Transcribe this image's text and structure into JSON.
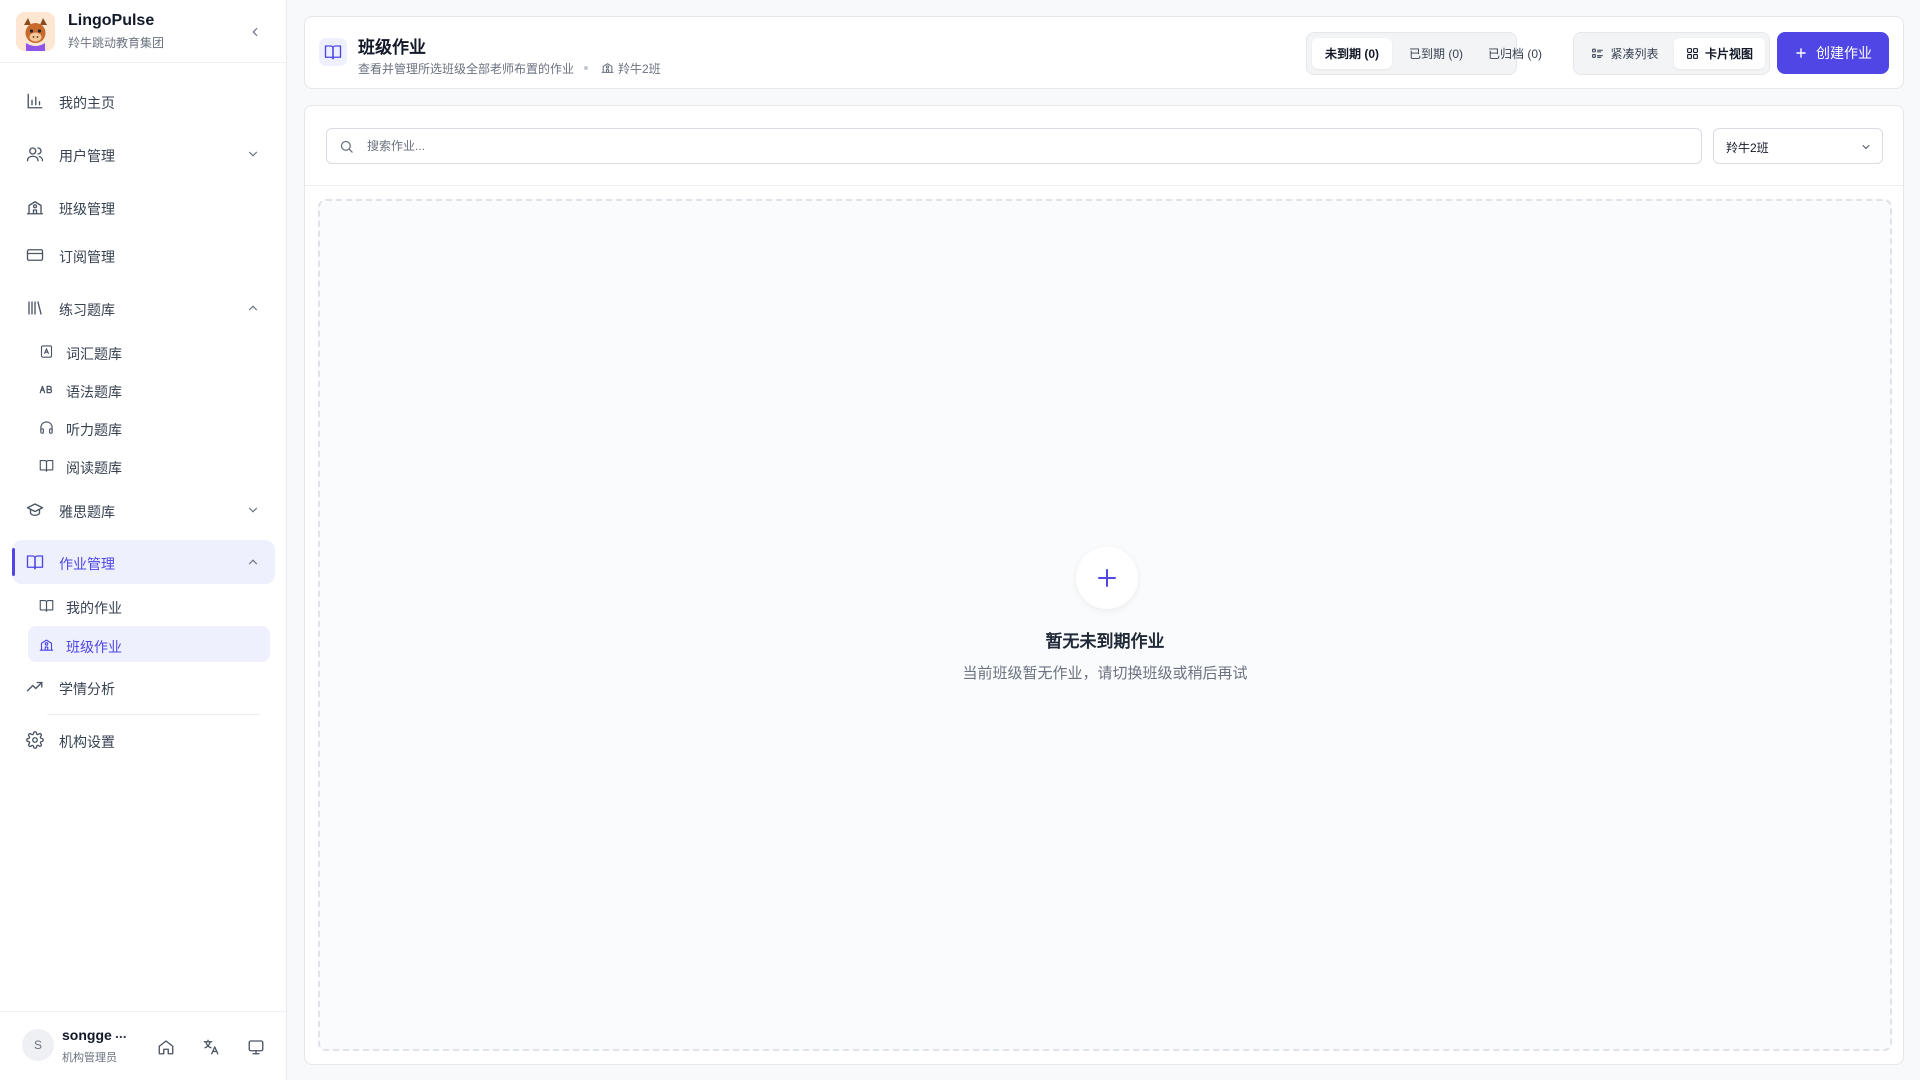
{
  "brand": {
    "name": "LingoPulse",
    "subtitle": "羚牛跳动教育集团"
  },
  "sidebar": {
    "items": [
      {
        "label": "我的主页",
        "icon": "bar-chart-icon"
      },
      {
        "label": "用户管理",
        "icon": "users-icon",
        "expandable": true,
        "expanded": false
      },
      {
        "label": "班级管理",
        "icon": "school-icon"
      },
      {
        "label": "订阅管理",
        "icon": "credit-card-icon"
      },
      {
        "label": "练习题库",
        "icon": "library-icon",
        "expandable": true,
        "expanded": true,
        "children": [
          {
            "label": "词汇题库",
            "icon": "vocab-icon"
          },
          {
            "label": "语法题库",
            "icon": "grammar-ab-icon"
          },
          {
            "label": "听力题库",
            "icon": "headphones-icon"
          },
          {
            "label": "阅读题库",
            "icon": "book-open-icon"
          }
        ]
      },
      {
        "label": "雅思题库",
        "icon": "graduation-cap-icon",
        "expandable": true,
        "expanded": false
      },
      {
        "label": "作业管理",
        "icon": "book-open-icon",
        "expandable": true,
        "expanded": true,
        "active": true,
        "children": [
          {
            "label": "我的作业",
            "icon": "book-open-icon"
          },
          {
            "label": "班级作业",
            "icon": "school-icon",
            "active": true
          }
        ]
      },
      {
        "label": "学情分析",
        "icon": "trending-up-icon"
      },
      {
        "label": "机构设置",
        "icon": "gear-icon"
      }
    ]
  },
  "user": {
    "initial": "S",
    "name": "songge",
    "more": "...",
    "role": "机构管理员"
  },
  "header": {
    "title": "班级作业",
    "subtitle": "查看并管理所选班级全部老师布置的作业",
    "class_name": "羚牛2班",
    "filters": [
      "未到期 (0)",
      "已到期 (0)",
      "已归档 (0)"
    ],
    "active_filter": 0,
    "views": [
      "紧凑列表",
      "卡片视图"
    ],
    "active_view": 1,
    "create_label": "创建作业"
  },
  "toolbar": {
    "search_placeholder": "搜索作业...",
    "class_select": "羚牛2班"
  },
  "empty_state": {
    "title": "暂无未到期作业",
    "description": "当前班级暂无作业，请切换班级或稍后再试"
  },
  "colors": {
    "accent": "#4f46e5",
    "accent_bg": "#eef0fe",
    "text": "#1f2937",
    "muted": "#6b7280"
  }
}
